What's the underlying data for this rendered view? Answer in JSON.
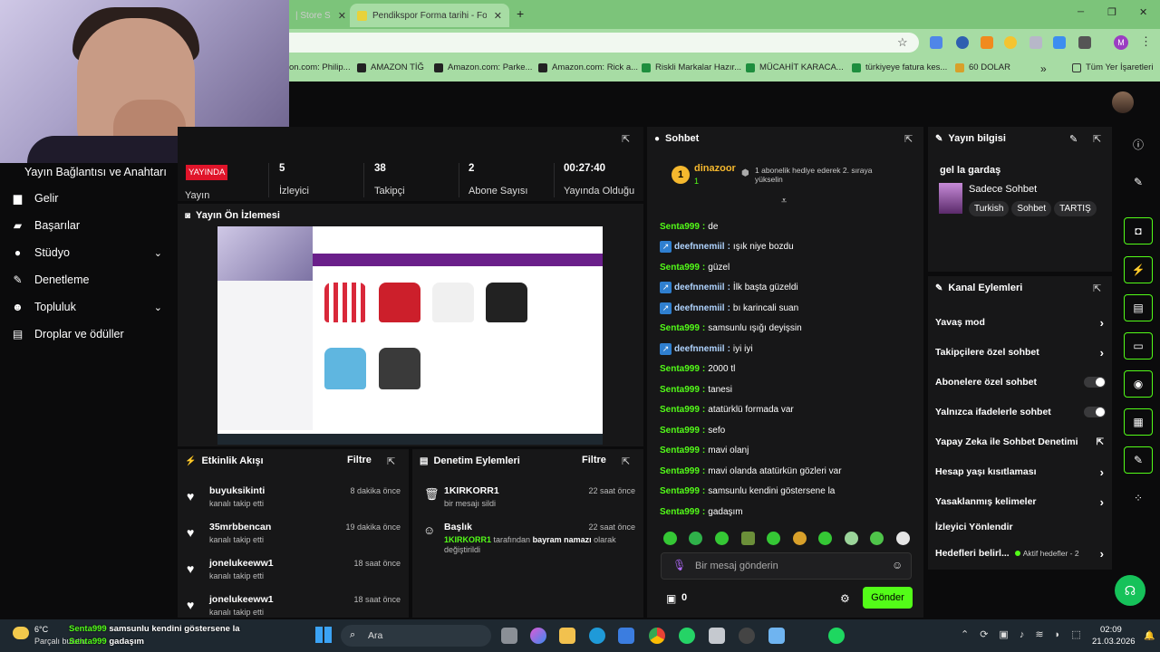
{
  "browser": {
    "tabs": [
      {
        "label": "| Store S",
        "active": false
      },
      {
        "label": "Pendikspor Forma tarihi - Footb",
        "active": true
      }
    ],
    "new_tab_symbol": "+",
    "window_controls": {
      "minimize": "─",
      "maximize": "❐",
      "close": "✕"
    },
    "bookmarks": [
      "on.com: Philip...",
      "AMAZON TİĞ",
      "Amazon.com: Parke...",
      "Amazon.com: Rick a...",
      "Riskli Markalar Hazır...",
      "MÜCAHİT KARACA...",
      "türkiyeye fatura kes...",
      "60 DOLAR"
    ],
    "bookmarks_more": "»",
    "all_bookmarks": "Tüm Yer İşaretleri",
    "profile_initial": "M"
  },
  "sidebar": {
    "title": "Yayın Bağlantısı ve Anahtarı",
    "items": [
      {
        "label": "Gelir",
        "icon": "chart-icon",
        "chevron": false
      },
      {
        "label": "Başarılar",
        "icon": "trophy-icon",
        "chevron": false
      },
      {
        "label": "Stüdyo",
        "icon": "studio-icon",
        "chevron": true
      },
      {
        "label": "Denetleme",
        "icon": "wrench-icon",
        "chevron": false
      },
      {
        "label": "Topluluk",
        "icon": "people-icon",
        "chevron": true
      },
      {
        "label": "Droplar ve ödüller",
        "icon": "gift-icon",
        "chevron": false
      }
    ]
  },
  "stats": {
    "live_badge": "YAYINDA",
    "live_label": "Yayın",
    "viewers": {
      "value": "5",
      "label": "İzleyici"
    },
    "followers": {
      "value": "38",
      "label": "Takipçi"
    },
    "subscribers": {
      "value": "2",
      "label": "Abone Sayısı"
    },
    "uptime": {
      "value": "00:27:40",
      "label": "Yayında Olduğu"
    }
  },
  "preview": {
    "title": "Yayın Ön İzlemesi"
  },
  "activity_feed": {
    "title": "Etkinlik Akışı",
    "filter": "Filtre",
    "items": [
      {
        "name": "buyuksikinti",
        "action": "kanalı takip etti",
        "time": "8 dakika önce"
      },
      {
        "name": "35mrbbencan",
        "action": "kanalı takip etti",
        "time": "19 dakika önce"
      },
      {
        "name": "jonelukeeww1",
        "action": "kanalı takip etti",
        "time": "18 saat önce"
      },
      {
        "name": "jonelukeeww1",
        "action": "kanalı takip etti",
        "time": "18 saat önce"
      }
    ]
  },
  "moderation": {
    "title": "Denetim Eylemleri",
    "filter": "Filtre",
    "items": [
      {
        "name": "1KIRKORR1",
        "action": "bir mesajı sildi",
        "time": "22 saat önce"
      },
      {
        "name": "Başlık",
        "actor": "1KIRKORR1",
        "action_pre": "tarafından",
        "highlight": "bayram namazı",
        "action_post": "olarak değiştirildi",
        "time": "22 saat önce"
      }
    ]
  },
  "chat": {
    "title": "Sohbet",
    "top_gifter": {
      "name": "dinazoor",
      "rank": "1",
      "count": "1"
    },
    "gift_prompt": "1 abonelik hediye ederek 2. sıraya yükselin",
    "messages": [
      {
        "user": "Senta999",
        "text": "de",
        "badge": false
      },
      {
        "user": "deefnnemiil",
        "text": "ışık niye bozdu",
        "badge": true
      },
      {
        "user": "Senta999",
        "text": "güzel",
        "badge": false
      },
      {
        "user": "deefnnemiil",
        "text": "İlk başta güzeldi",
        "badge": true
      },
      {
        "user": "deefnnemiil",
        "text": "bı karincali suan",
        "badge": true
      },
      {
        "user": "Senta999",
        "text": "samsunlu ışığı deyişsin",
        "badge": false
      },
      {
        "user": "deefnnemiil",
        "text": "iyi iyi",
        "badge": true
      },
      {
        "user": "Senta999",
        "text": "2000 tl",
        "badge": false
      },
      {
        "user": "Senta999",
        "text": "tanesi",
        "badge": false
      },
      {
        "user": "Senta999",
        "text": "atatürklü formada var",
        "badge": false
      },
      {
        "user": "Senta999",
        "text": "sefo",
        "badge": false
      },
      {
        "user": "Senta999",
        "text": "mavi olanj",
        "badge": false
      },
      {
        "user": "Senta999",
        "text": "mavi olanda atatürkün gözleri var",
        "badge": false
      },
      {
        "user": "Senta999",
        "text": "samsunlu kendini göstersene la",
        "badge": false
      },
      {
        "user": "Senta999",
        "text": "gadaşım",
        "badge": false
      }
    ],
    "input_placeholder": "Bir mesaj gönderin",
    "points": "0",
    "send": "Gönder"
  },
  "stream_info": {
    "title": "Yayın bilgisi",
    "stream_title": "gel la gardaş",
    "category": "Sadece Sohbet",
    "tags": [
      "Turkish",
      "Sohbet",
      "TARTIŞ"
    ]
  },
  "channel_actions": {
    "title": "Kanal Eylemleri",
    "items": [
      {
        "label": "Yavaş mod",
        "kind": "chevron"
      },
      {
        "label": "Takipçilere özel sohbet",
        "kind": "chevron"
      },
      {
        "label": "Abonelere özel sohbet",
        "kind": "toggle"
      },
      {
        "label": "Yalnızca ifadelerle sohbet",
        "kind": "toggle"
      },
      {
        "label": "Yapay Zeka ile Sohbet Denetimi",
        "kind": "external"
      },
      {
        "label": "Hesap yaşı kısıtlaması",
        "kind": "chevron"
      },
      {
        "label": "Yasaklanmış kelimeler",
        "kind": "chevron"
      },
      {
        "label": "İzleyici Yönlendir",
        "kind": "none"
      },
      {
        "label": "Hedefleri belirl...",
        "kind": "goals",
        "extra": "Aktif hedefler - 2"
      }
    ]
  },
  "taskbar": {
    "weather_temp": "6°C",
    "weather_desc": "Parçalı bulutlu",
    "toast_user": "Senta999",
    "toast_line1": "samsunlu kendini göstersene la",
    "toast_line2": "gadaşım",
    "search": "Ara",
    "time": "02:09",
    "date": "21.03.2026"
  },
  "colors": {
    "accent": "#53fc18",
    "live": "#e0142a",
    "chrome": "#a7dca4"
  }
}
